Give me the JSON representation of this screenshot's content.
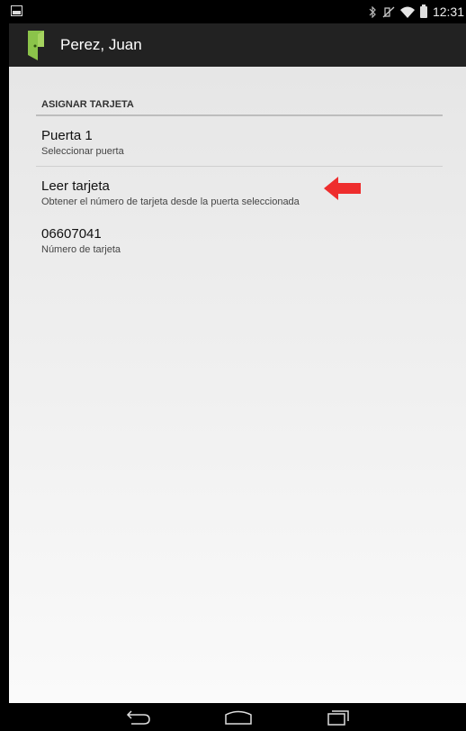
{
  "status_bar": {
    "time": "12:31",
    "icons": [
      "image-icon",
      "bluetooth-icon",
      "mute-icon",
      "wifi-icon",
      "battery-icon"
    ]
  },
  "action_bar": {
    "title": "Perez, Juan",
    "app_icon": "door-icon",
    "accent_color": "#8bc34a"
  },
  "section": {
    "header": "ASIGNAR TARJETA"
  },
  "prefs": [
    {
      "title": "Puerta 1",
      "summary": "Seleccionar puerta"
    },
    {
      "title": "Leer tarjeta",
      "summary": "Obtener el número de tarjeta desde la puerta seleccionada"
    },
    {
      "title": "06607041",
      "summary": "Número de tarjeta"
    }
  ],
  "annotation": {
    "icon": "red-arrow-icon",
    "color": "#ee2d2d"
  },
  "nav_bar": {
    "icons": [
      "back-icon",
      "home-icon",
      "recents-icon"
    ]
  }
}
